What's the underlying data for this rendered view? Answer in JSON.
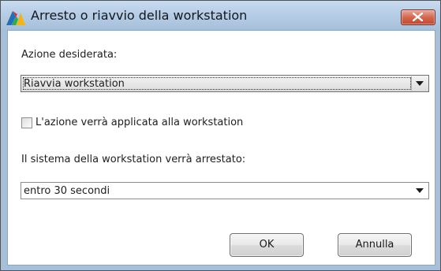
{
  "window": {
    "title": "Arresto o riavvio della workstation",
    "app_icon": "avg-logo-icon",
    "close_icon": "close-icon"
  },
  "action": {
    "label": "Azione desiderata:",
    "selected": "Riavvia workstation"
  },
  "apply_checkbox": {
    "label": "L'azione verrà applicata alla workstation",
    "checked": false
  },
  "timing": {
    "label": "Il sistema della workstation verrà arrestato:",
    "selected": "entro 30 secondi"
  },
  "buttons": {
    "ok": "OK",
    "cancel": "Annulla"
  },
  "colors": {
    "titlebar": "#b6cde6",
    "close_button": "#d5674f"
  }
}
